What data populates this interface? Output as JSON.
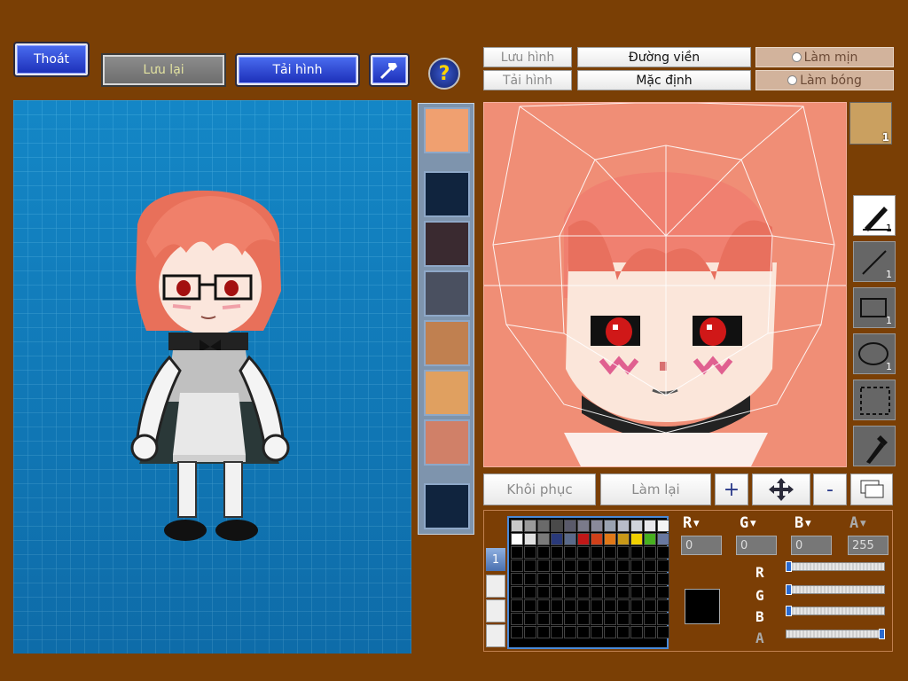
{
  "toolbar": {
    "exit_label": "Thoát",
    "save_label": "Lưu lại",
    "load_label": "Tải hình"
  },
  "editor_buttons": {
    "save_image": "Lưu hình",
    "load_image": "Tải hình",
    "outline": "Đường viền",
    "default": "Mặc định",
    "smooth": "Làm mịn",
    "shade": "Làm bóng",
    "restore": "Khôi phục",
    "redo": "Làm lại",
    "plus": "+",
    "minus": "-"
  },
  "tools": [
    {
      "name": "pen",
      "count": "1"
    },
    {
      "name": "line",
      "count": "1"
    },
    {
      "name": "rectangle",
      "count": "1"
    },
    {
      "name": "ellipse",
      "count": "1"
    },
    {
      "name": "select",
      "count": ""
    },
    {
      "name": "eyedropper",
      "count": ""
    }
  ],
  "avatar_badge": "1",
  "color": {
    "r_value": "0",
    "g_value": "0",
    "b_value": "0",
    "a_value": "255",
    "current": "#000000",
    "swatches": [
      "#c8c8c8",
      "#9a9a9a",
      "#6a6a6a",
      "#4a4a4a",
      "#5a5a6a",
      "#7a7a8a",
      "#8a8a9a",
      "#9aa2b0",
      "#b8bcc8",
      "#d0d4dc",
      "#e8e8ec",
      "#f4f4f4",
      "#ffffff",
      "#e0e0e0",
      "#7a7a7a",
      "#2a3a7a",
      "#5a6a8a",
      "#c01818",
      "#d0401a",
      "#e07818",
      "#c89818",
      "#f0d000",
      "#48b020",
      "#6878a0"
    ],
    "tab_label": "1"
  },
  "colors": {
    "bg": "#7a3f05",
    "accent_blue": "#1c2fb8",
    "canvas_salmon": "#f08e76"
  }
}
